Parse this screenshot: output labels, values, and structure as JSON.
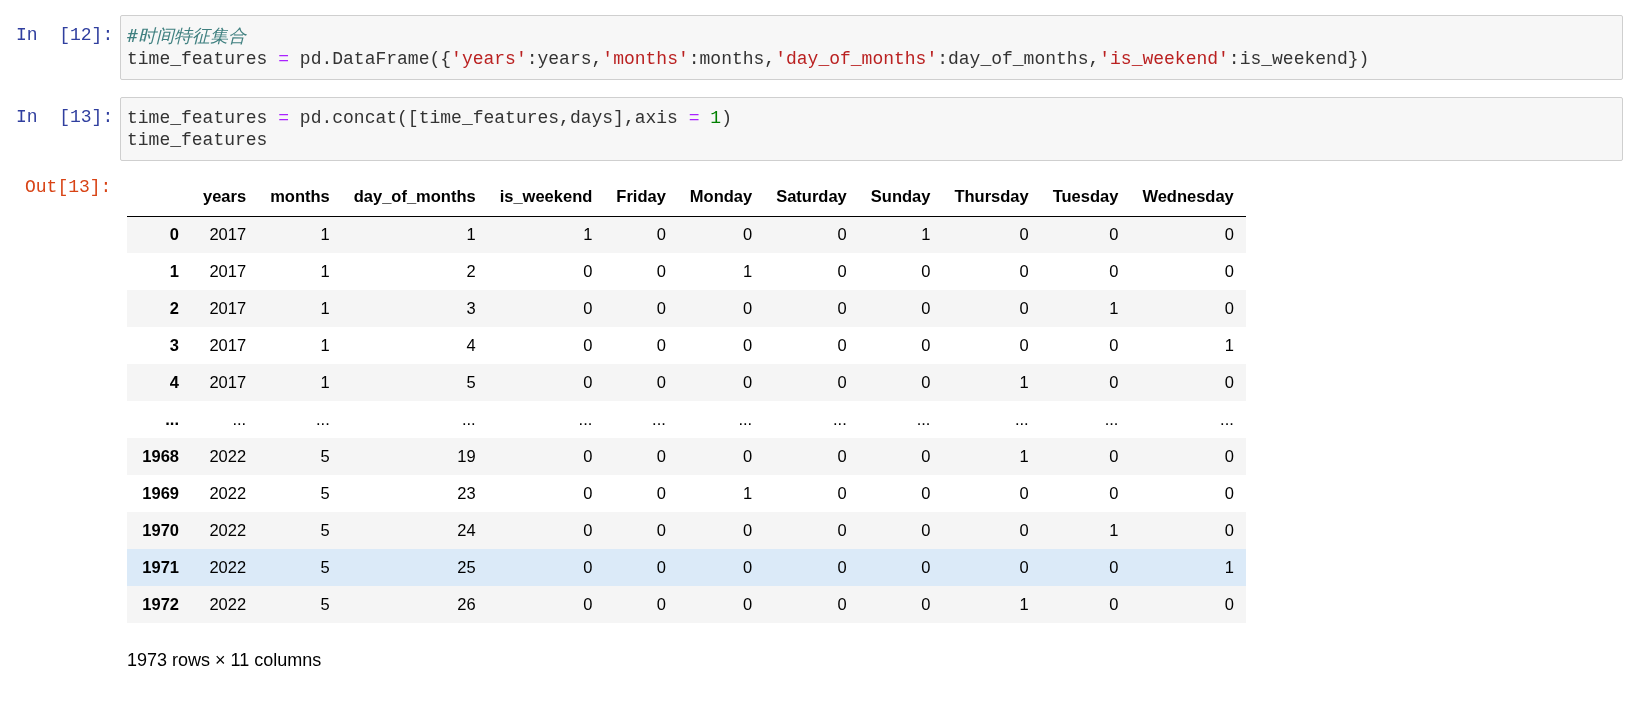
{
  "cells": [
    {
      "prompt": "In  [12]:",
      "lines": [
        [
          {
            "kind": "comment",
            "text": "#时间特征集合"
          }
        ],
        [
          {
            "kind": "plain",
            "text": "time_features "
          },
          {
            "kind": "op",
            "text": "="
          },
          {
            "kind": "plain",
            "text": " pd.DataFrame({"
          },
          {
            "kind": "string",
            "text": "'years'"
          },
          {
            "kind": "plain",
            "text": ":years,"
          },
          {
            "kind": "string",
            "text": "'months'"
          },
          {
            "kind": "plain",
            "text": ":months,"
          },
          {
            "kind": "string",
            "text": "'day_of_months'"
          },
          {
            "kind": "plain",
            "text": ":day_of_months,"
          },
          {
            "kind": "string",
            "text": "'is_weekend'"
          },
          {
            "kind": "plain",
            "text": ":is_weekend})"
          }
        ]
      ]
    },
    {
      "prompt": "In  [13]:",
      "lines": [
        [
          {
            "kind": "plain",
            "text": "time_features "
          },
          {
            "kind": "op",
            "text": "="
          },
          {
            "kind": "plain",
            "text": " pd.concat([time_features,days],axis "
          },
          {
            "kind": "op",
            "text": "="
          },
          {
            "kind": "number",
            "text": " 1"
          },
          {
            "kind": "plain",
            "text": ")"
          }
        ],
        [
          {
            "kind": "plain",
            "text": "time_features"
          }
        ]
      ]
    }
  ],
  "output": {
    "prompt": "Out[13]:",
    "table": {
      "columns": [
        "years",
        "months",
        "day_of_months",
        "is_weekend",
        "Friday",
        "Monday",
        "Saturday",
        "Sunday",
        "Thursday",
        "Tuesday",
        "Wednesday"
      ],
      "rows": [
        {
          "index": "0",
          "selected": false,
          "cells": [
            "2017",
            "1",
            "1",
            "1",
            "0",
            "0",
            "0",
            "1",
            "0",
            "0",
            "0"
          ]
        },
        {
          "index": "1",
          "selected": false,
          "cells": [
            "2017",
            "1",
            "2",
            "0",
            "0",
            "1",
            "0",
            "0",
            "0",
            "0",
            "0"
          ]
        },
        {
          "index": "2",
          "selected": false,
          "cells": [
            "2017",
            "1",
            "3",
            "0",
            "0",
            "0",
            "0",
            "0",
            "0",
            "1",
            "0"
          ]
        },
        {
          "index": "3",
          "selected": false,
          "cells": [
            "2017",
            "1",
            "4",
            "0",
            "0",
            "0",
            "0",
            "0",
            "0",
            "0",
            "1"
          ]
        },
        {
          "index": "4",
          "selected": false,
          "cells": [
            "2017",
            "1",
            "5",
            "0",
            "0",
            "0",
            "0",
            "0",
            "1",
            "0",
            "0"
          ]
        },
        {
          "index": "...",
          "selected": false,
          "cells": [
            "...",
            "...",
            "...",
            "...",
            "...",
            "...",
            "...",
            "...",
            "...",
            "...",
            "..."
          ]
        },
        {
          "index": "1968",
          "selected": false,
          "cells": [
            "2022",
            "5",
            "19",
            "0",
            "0",
            "0",
            "0",
            "0",
            "1",
            "0",
            "0"
          ]
        },
        {
          "index": "1969",
          "selected": false,
          "cells": [
            "2022",
            "5",
            "23",
            "0",
            "0",
            "1",
            "0",
            "0",
            "0",
            "0",
            "0"
          ]
        },
        {
          "index": "1970",
          "selected": false,
          "cells": [
            "2022",
            "5",
            "24",
            "0",
            "0",
            "0",
            "0",
            "0",
            "0",
            "1",
            "0"
          ]
        },
        {
          "index": "1971",
          "selected": true,
          "cells": [
            "2022",
            "5",
            "25",
            "0",
            "0",
            "0",
            "0",
            "0",
            "0",
            "0",
            "1"
          ]
        },
        {
          "index": "1972",
          "selected": false,
          "cells": [
            "2022",
            "5",
            "26",
            "0",
            "0",
            "0",
            "0",
            "0",
            "1",
            "0",
            "0"
          ]
        }
      ]
    },
    "summary": "1973 rows × 11 columns"
  }
}
